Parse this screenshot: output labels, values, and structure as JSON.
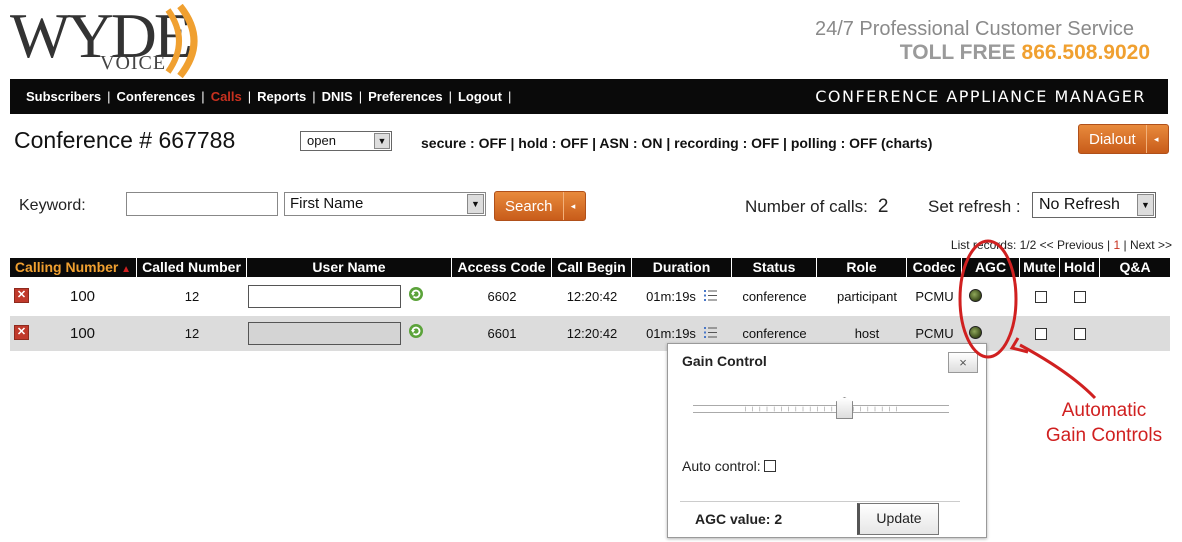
{
  "brand": {
    "logo_text": "WYDE",
    "logo_sub": "VOICE",
    "tagline": "24/7 Professional Customer Service",
    "tollfree_label": "TOLL FREE",
    "tollfree_number": "866.508.9020",
    "accent": "#f0a030"
  },
  "nav": {
    "items": [
      "Subscribers",
      "Conferences",
      "Calls",
      "Reports",
      "DNIS",
      "Preferences",
      "Logout"
    ],
    "active": "Calls",
    "right_title": "CONFERENCE APPLIANCE MANAGER"
  },
  "conference": {
    "title": "Conference # 667788",
    "state": "open",
    "status": "secure : OFF  |  hold : OFF  |  ASN : ON  |  recording : OFF  |  polling : OFF (charts)",
    "dialout_label": "Dialout"
  },
  "search": {
    "keyword_label": "Keyword:",
    "keyword_value": "",
    "field": "First Name",
    "button_label": "Search",
    "num_calls_label": "Number of calls:",
    "num_calls": "2",
    "refresh_label": "Set refresh :",
    "refresh_value": "No Refresh"
  },
  "pager": {
    "prefix": "List records: 1/2",
    "prev": "<< Previous",
    "current": "1",
    "next": "Next >>"
  },
  "table": {
    "headers": [
      "Calling Number",
      "Called Number",
      "User Name",
      "Access Code",
      "Call Begin",
      "Duration",
      "Status",
      "Role",
      "Codec",
      "AGC",
      "Mute",
      "Hold",
      "Q&A"
    ],
    "rows": [
      {
        "calling": "100",
        "called": "12",
        "user": "",
        "access": "6602",
        "begin": "12:20:42",
        "duration": "01m:19s",
        "status": "conference",
        "role": "participant",
        "codec": "PCMU"
      },
      {
        "calling": "100",
        "called": "12",
        "user": "",
        "access": "6601",
        "begin": "12:20:42",
        "duration": "01m:19s",
        "status": "conference",
        "role": "host",
        "codec": "PCMU"
      }
    ]
  },
  "dialog": {
    "title": "Gain Control",
    "close": "×",
    "auto_control_label": "Auto control:",
    "agc_value_label": "AGC value: 2",
    "update_label": "Update",
    "slider_level": 0.59
  },
  "annotation": {
    "line1": "Automatic",
    "line2": "Gain Controls",
    "color": "#d02020"
  }
}
